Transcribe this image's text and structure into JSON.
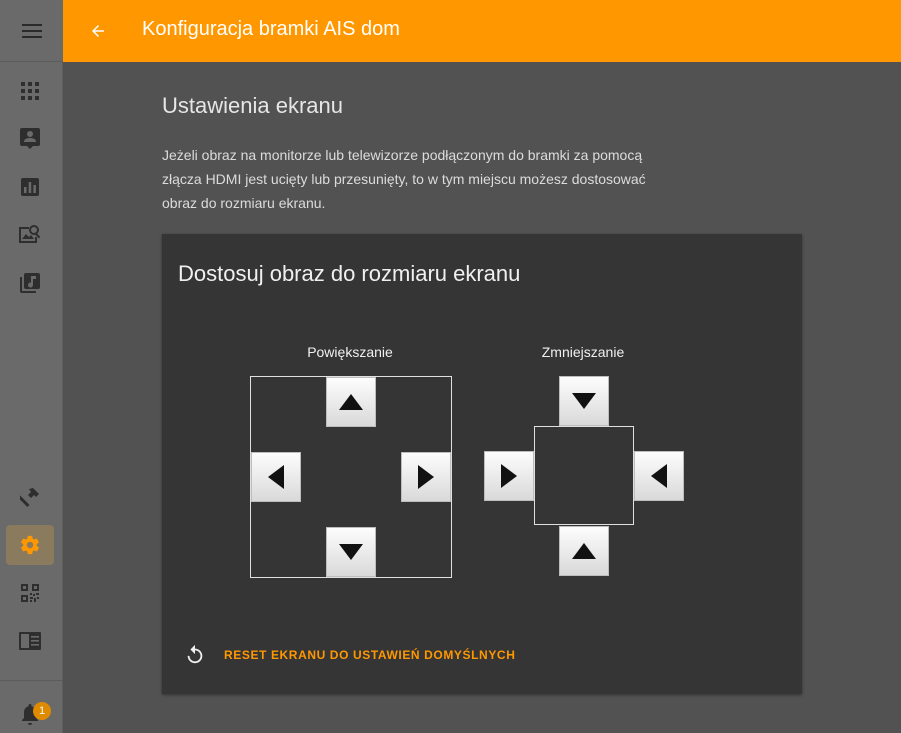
{
  "header": {
    "title": "Konfiguracja bramki AIS dom"
  },
  "sidebar": {
    "items": [
      {
        "icon": "apps-grid-icon"
      },
      {
        "icon": "person-card-icon"
      },
      {
        "icon": "bar-chart-icon"
      },
      {
        "icon": "image-search-icon"
      },
      {
        "icon": "music-library-icon"
      },
      {
        "icon": "hammer-icon"
      },
      {
        "icon": "gear-icon",
        "active": true
      },
      {
        "icon": "qr-code-icon"
      },
      {
        "icon": "book-panel-icon"
      }
    ],
    "notifications": {
      "icon": "bell-icon",
      "count": "1"
    }
  },
  "main": {
    "title": "Ustawienia ekranu",
    "description": "Jeżeli obraz na monitorze lub telewizorze podłączonym do bramki za pomocą złącza HDMI jest ucięty lub przesunięty, to w tym miejscu możesz dostosować obraz do rozmiaru ekranu.",
    "card": {
      "title": "Dostosuj obraz do rozmiaru ekranu",
      "enlarge_label": "Powiększanie",
      "shrink_label": "Zmniejszanie",
      "reset_label": "RESET EKRANU DO USTAWIEŃ DOMYŚLNYCH"
    }
  },
  "colors": {
    "accent": "#ff9800",
    "background": "#525252",
    "card": "#353535",
    "sidebar": "#6a6a6a"
  }
}
